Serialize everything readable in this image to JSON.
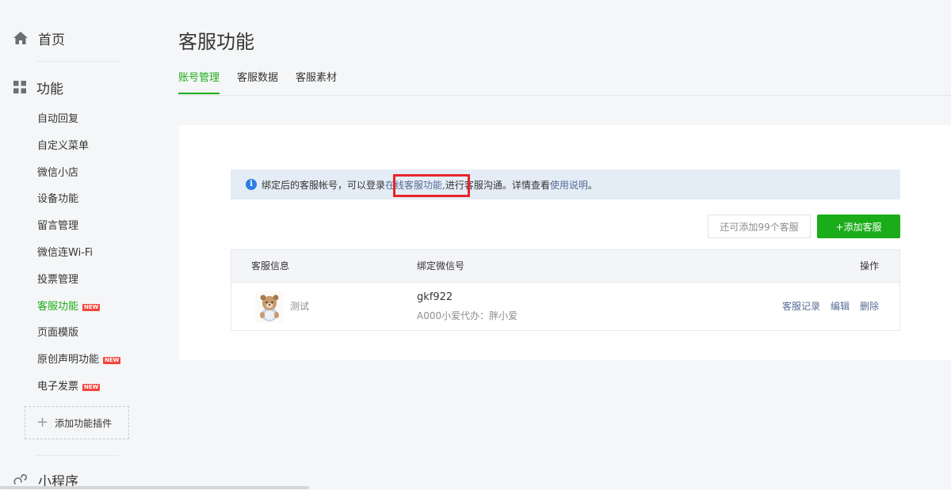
{
  "sidebar": {
    "home_label": "首页",
    "function_label": "功能",
    "items": [
      {
        "label": "自动回复",
        "badge": ""
      },
      {
        "label": "自定义菜单",
        "badge": ""
      },
      {
        "label": "微信小店",
        "badge": ""
      },
      {
        "label": "设备功能",
        "badge": ""
      },
      {
        "label": "留言管理",
        "badge": ""
      },
      {
        "label": "微信连Wi-Fi",
        "badge": ""
      },
      {
        "label": "投票管理",
        "badge": ""
      },
      {
        "label": "客服功能",
        "badge": "NEW"
      },
      {
        "label": "页面模版",
        "badge": ""
      },
      {
        "label": "原创声明功能",
        "badge": "NEW"
      },
      {
        "label": "电子发票",
        "badge": "NEW"
      }
    ],
    "active_item": "客服功能",
    "add_plugin_label": "添加功能插件",
    "mini_program_label": "小程序"
  },
  "main": {
    "title": "客服功能",
    "tabs": [
      {
        "label": "账号管理",
        "active": true
      },
      {
        "label": "客服数据",
        "active": false
      },
      {
        "label": "客服素材",
        "active": false
      }
    ],
    "notice": {
      "text_before": "绑定后的客服帐号，可以登录",
      "link_text": "在线客服功能,",
      "text_middle": "进行客服沟通。详情查看",
      "help_link": "使用说明",
      "text_after": "。"
    },
    "remaining_label": "还可添加99个客服",
    "add_button_label": "+添加客服",
    "table": {
      "headers": [
        "客服信息",
        "绑定微信号",
        "操作"
      ],
      "rows": [
        {
          "name": "测试",
          "wechat_id": "gkf922",
          "wechat_sub": "A000小爱代办：胖小爱",
          "actions": [
            "客服记录",
            "编辑",
            "删除"
          ]
        }
      ]
    }
  },
  "colors": {
    "accent": "#1aad19",
    "link": "#576b95",
    "notice_bg": "#e4ecf5",
    "highlight": "#e8242a",
    "badge": "#f2443a"
  }
}
